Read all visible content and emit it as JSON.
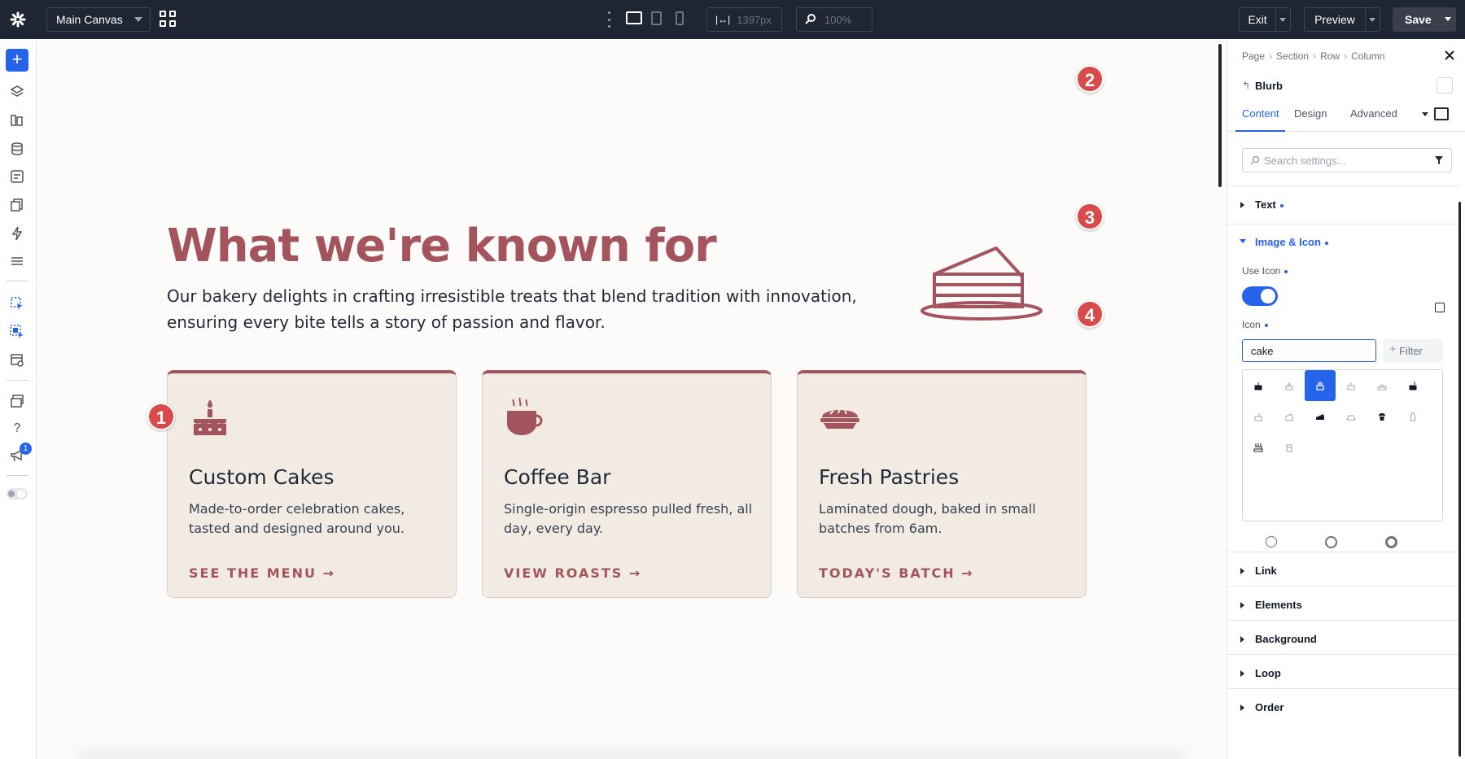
{
  "topbar": {
    "canvas_select": "Main Canvas",
    "width_value": "1397px",
    "zoom_value": "100%",
    "exit_label": "Exit",
    "preview_label": "Preview",
    "save_label": "Save"
  },
  "rail": {
    "notification_count": "1",
    "help_glyph": "?"
  },
  "canvas": {
    "headline": "What we're known for",
    "subtext": "Our bakery delights in crafting irresistible treats that blend tradition with innovation, ensuring every bite tells a story of passion and flavor.",
    "cards": [
      {
        "icon": "cake-icon",
        "title": "Custom Cakes",
        "description": "Made-to-order celebration cakes, tasted and designed around you.",
        "link": "SEE THE MENU →"
      },
      {
        "icon": "coffee-cup-icon",
        "title": "Coffee Bar",
        "description": "Single-origin espresso pulled fresh, all day, every day.",
        "link": "VIEW ROASTS →"
      },
      {
        "icon": "pie-icon",
        "title": "Fresh Pastries",
        "description": "Laminated dough, baked in small batches from 6am.",
        "link": "TODAY'S BATCH →"
      }
    ],
    "accent_color": "#a4545c",
    "card_bg": "#f1ebe4"
  },
  "markers": [
    "1",
    "2",
    "3",
    "4"
  ],
  "panel": {
    "breadcrumb": [
      "Page",
      "Section",
      "Row",
      "Column"
    ],
    "module_name": "Blurb",
    "tabs": [
      {
        "label": "Content",
        "active": true
      },
      {
        "label": "Design",
        "active": false
      },
      {
        "label": "Advanced",
        "active": false
      }
    ],
    "search_placeholder": "Search settings...",
    "sections": {
      "text": "Text",
      "image_icon": "Image & Icon",
      "link": "Link",
      "elements": "Elements",
      "background": "Background",
      "loop": "Loop",
      "order": "Order"
    },
    "use_icon_label": "Use Icon",
    "use_icon_on": true,
    "icon_label": "Icon",
    "icon_search_value": "cake",
    "filter_label": "Filter",
    "icon_results_count": 14,
    "selected_icon_index": 2
  }
}
